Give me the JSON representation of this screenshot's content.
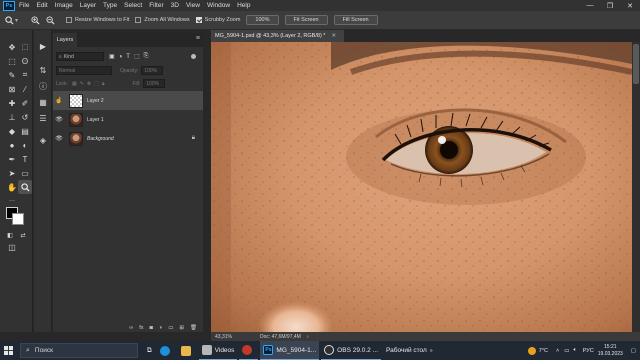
{
  "menubar": {
    "items": [
      "File",
      "Edit",
      "Image",
      "Layer",
      "Type",
      "Select",
      "Filter",
      "3D",
      "View",
      "Window",
      "Help"
    ]
  },
  "options": {
    "resize_windows": "Resize Windows to Fit",
    "zoom_all": "Zoom All Windows",
    "scrubby": "Scrubby Zoom",
    "zoom_value": "100%",
    "fit_screen": "Fit Screen",
    "fill_screen": "Fill Screen"
  },
  "layers": {
    "tab": "Layers",
    "kind": "Kind",
    "blend_mode": "Normal",
    "opacity_label": "Opacity:",
    "opacity_value": "100%",
    "lock_label": "Lock:",
    "fill_label": "Fill:",
    "fill_value": "100%",
    "rows": [
      {
        "name": "Layer 2"
      },
      {
        "name": "Layer 1"
      },
      {
        "name": "Background"
      }
    ]
  },
  "document": {
    "tab_title": "MG_5904-1.psd @ 43,3% (Layer 2, RGB/8) *",
    "zoom": "43,31%",
    "doc_info": "Doc: 47,6M/97,4M"
  },
  "taskbar": {
    "search_placeholder": "Поиск",
    "apps": [
      "Videos",
      "MG_5904-1...",
      "OBS 29.0.2 ...",
      "Рабочий стол"
    ],
    "weather": "7°C",
    "language": "РУС",
    "time": "15:21",
    "date": "19.03.2023"
  },
  "colors": {
    "accent_ps": "#31a8ff",
    "panel": "#323232",
    "taskbar": "#202833"
  }
}
